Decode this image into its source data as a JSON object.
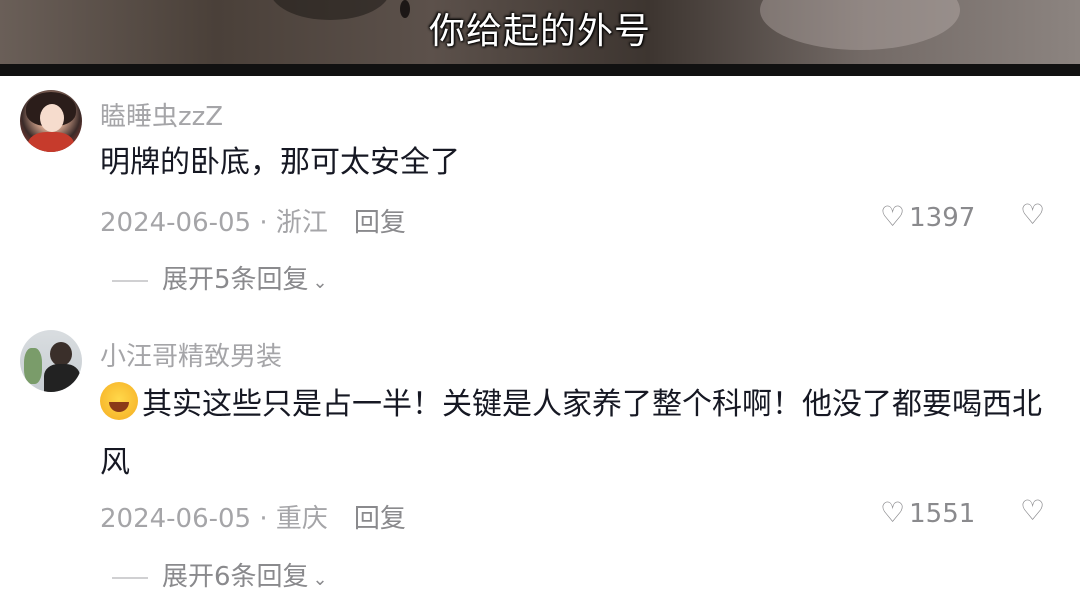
{
  "video": {
    "subtitle": "你给起的外号"
  },
  "comments": [
    {
      "username": "瞌睡虫zzZ",
      "text": "明牌的卧底，那可太安全了",
      "date_location": "2024-06-05 · 浙江",
      "reply_label": "回复",
      "likes": "1397",
      "expand_label": "展开5条回复"
    },
    {
      "username": "小汪哥精致男装",
      "text": "其实这些只是占一半！关键是人家养了整个科啊！他没了都要喝西北风",
      "date_location": "2024-06-05 · 重庆",
      "reply_label": "回复",
      "likes": "1551",
      "expand_label": "展开6条回复"
    }
  ],
  "icons": {
    "like": "heart-outline-icon",
    "dislike": "broken-heart-icon",
    "expand": "chevron-down-icon",
    "emoji": "laughing-tears-emoji"
  }
}
